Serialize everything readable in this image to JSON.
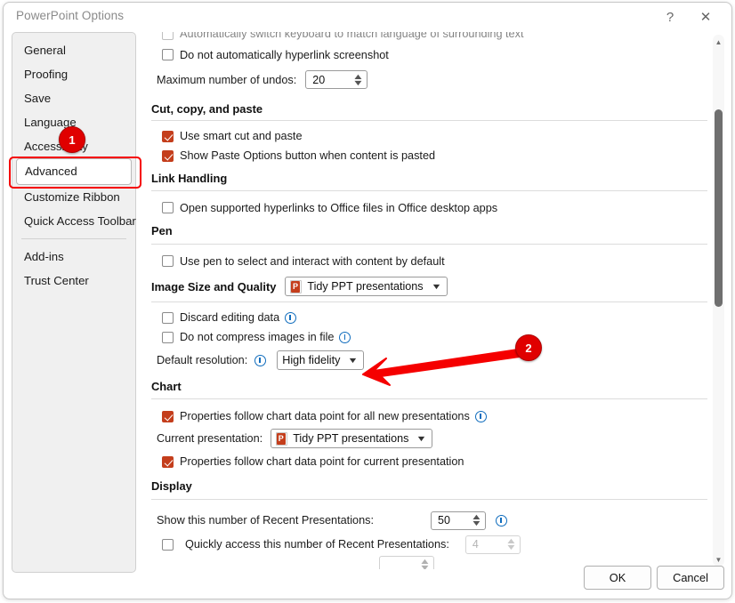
{
  "window": {
    "title": "PowerPoint Options",
    "help_icon": "?",
    "close_icon": "✕"
  },
  "sidebar": {
    "items": [
      {
        "label": "General",
        "selected": false
      },
      {
        "label": "Proofing",
        "selected": false
      },
      {
        "label": "Save",
        "selected": false
      },
      {
        "label": "Language",
        "selected": false
      },
      {
        "label": "Accessibility",
        "selected": false
      },
      {
        "label": "Advanced",
        "selected": true
      },
      {
        "label": "Customize Ribbon",
        "selected": false
      },
      {
        "label": "Quick Access Toolbar",
        "selected": false
      },
      {
        "label": "Add-ins",
        "selected": false
      },
      {
        "label": "Trust Center",
        "selected": false
      }
    ]
  },
  "content": {
    "clipped_top_row": "Automatically switch keyboard to match language of surrounding text",
    "hyperlink_screenshot": "Do not automatically hyperlink screenshot",
    "max_undos_label": "Maximum number of undos:",
    "max_undos_value": "20",
    "cut_copy_paste_header": "Cut, copy, and paste",
    "smart_cut_paste": "Use smart cut and paste",
    "show_paste_options": "Show Paste Options button when content is pasted",
    "link_handling_header": "Link Handling",
    "open_supported_hyperlinks": "Open supported hyperlinks to Office files in Office desktop apps",
    "pen_header": "Pen",
    "use_pen": "Use pen to select and interact with content by default",
    "image_size_header": "Image Size and Quality",
    "image_size_presentation": "Tidy PPT presentations",
    "discard_editing_data": "Discard editing data",
    "do_not_compress": "Do not compress images in file",
    "default_resolution_label": "Default resolution:",
    "default_resolution_value": "High fidelity",
    "chart_header": "Chart",
    "props_follow_all_new": "Properties follow chart data point for all new presentations",
    "current_presentation_label": "Current presentation:",
    "current_presentation_value": "Tidy PPT presentations",
    "props_follow_current": "Properties follow chart data point for current presentation",
    "display_header": "Display",
    "recent_presentations_label": "Show this number of Recent Presentations:",
    "recent_presentations_value": "50",
    "quick_access_label": "Quickly access this number of Recent Presentations:",
    "quick_access_value": "4"
  },
  "footer": {
    "ok_label": "OK",
    "cancel_label": "Cancel"
  },
  "scrollbar": {
    "up_arrow": "▲",
    "down_arrow": "▼"
  },
  "annotations": {
    "badge_1": "1",
    "badge_2": "2",
    "accent_color": "#e00000",
    "highlight_color": "#f50000"
  },
  "theme": {
    "checkbox_color": "#c43e1c",
    "info_icon_color": "#0f6cbd"
  }
}
